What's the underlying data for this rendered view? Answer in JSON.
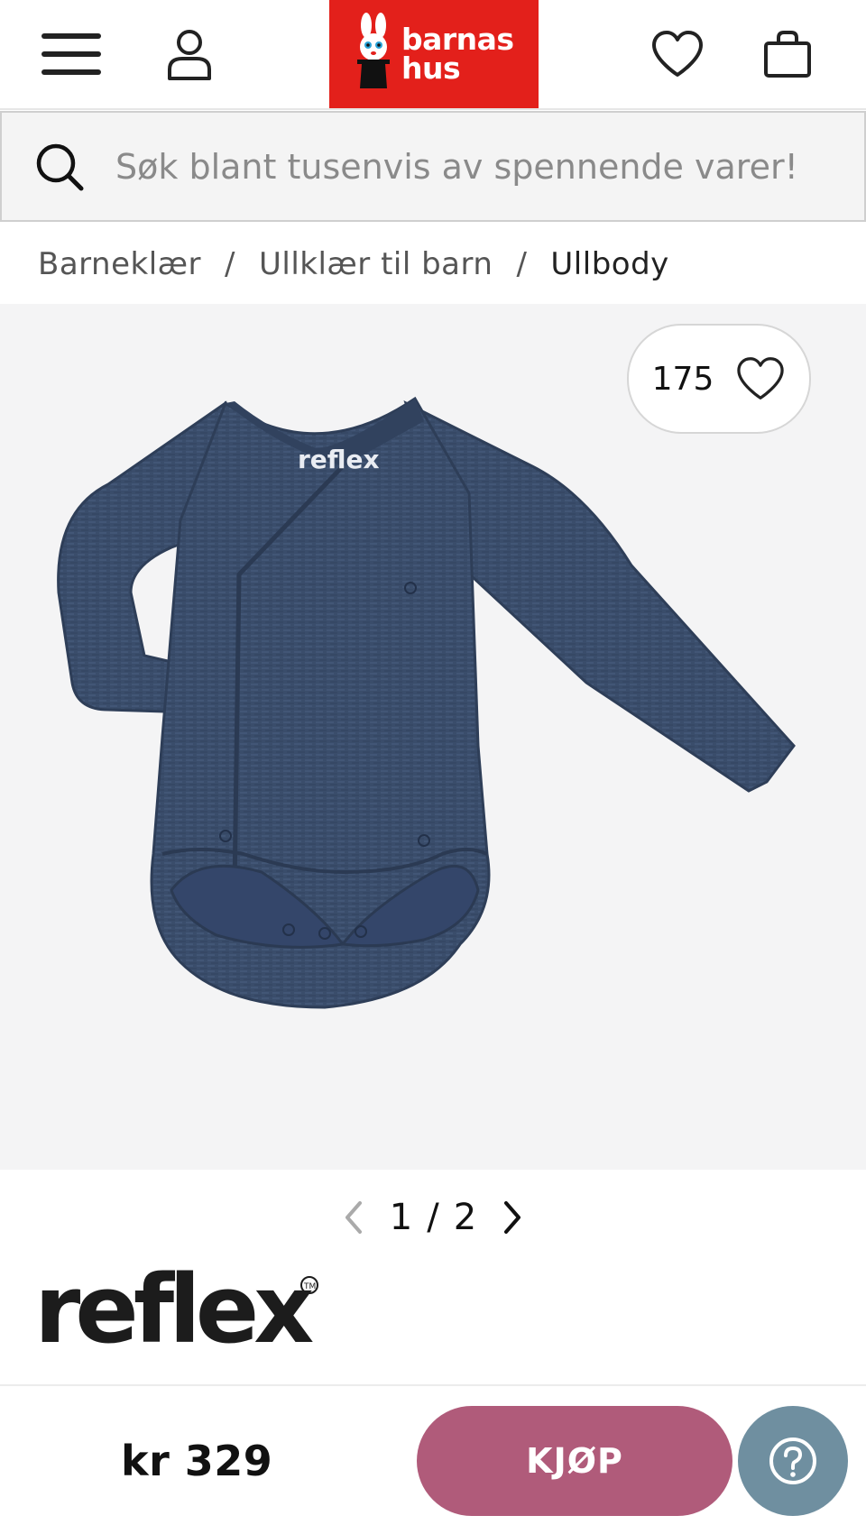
{
  "header": {
    "menu_icon": "hamburger-menu-icon",
    "account_icon": "user-icon",
    "logo_line1": "barnas",
    "logo_line2": "hus",
    "wishlist_icon": "heart-icon",
    "cart_icon": "shopping-bag-icon",
    "brand_color": "#e3201b"
  },
  "search": {
    "placeholder": "Søk blant tusenvis av spennende varer!",
    "icon": "search-icon"
  },
  "breadcrumb": {
    "items": [
      "Barneklær",
      "Ullklær til barn",
      "Ullbody"
    ],
    "separator": "/"
  },
  "gallery": {
    "favorite_count": "175",
    "image_alt": "Reflex ullbody, navy",
    "image_label": "reflex",
    "pager": {
      "current": "1",
      "separator": "/",
      "total": "2"
    }
  },
  "product": {
    "brand": "reflex",
    "price": "kr 329"
  },
  "actions": {
    "buy_label": "KJØP",
    "buy_color": "#b05b7a",
    "help_color": "#6f8fa0"
  }
}
